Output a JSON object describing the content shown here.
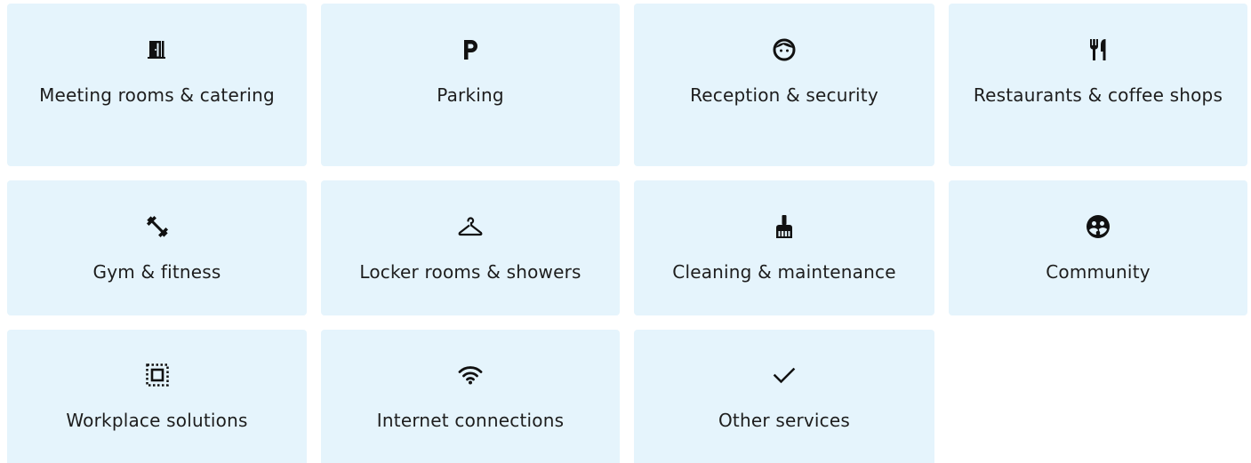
{
  "services": [
    {
      "label": "Meeting rooms & catering",
      "icon": "door-icon"
    },
    {
      "label": "Parking",
      "icon": "parking-icon"
    },
    {
      "label": "Reception & security",
      "icon": "face-icon"
    },
    {
      "label": "Restaurants & coffee shops",
      "icon": "fork-knife-icon"
    },
    {
      "label": "Gym & fitness",
      "icon": "dumbbell-icon"
    },
    {
      "label": "Locker rooms & showers",
      "icon": "hanger-icon"
    },
    {
      "label": "Cleaning & maintenance",
      "icon": "broom-icon"
    },
    {
      "label": "Community",
      "icon": "community-icon"
    },
    {
      "label": "Workplace solutions",
      "icon": "select-area-icon"
    },
    {
      "label": "Internet connections",
      "icon": "wifi-icon"
    },
    {
      "label": "Other services",
      "icon": "check-icon"
    }
  ],
  "colors": {
    "card_background": "#e5f4fc",
    "text": "#1d1d1d",
    "icon": "#111111"
  }
}
